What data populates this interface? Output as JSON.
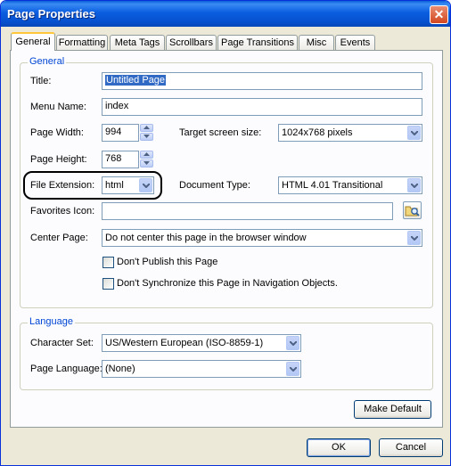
{
  "window": {
    "title": "Page Properties",
    "close_glyph": "✕"
  },
  "tabs": [
    "General",
    "Formatting",
    "Meta Tags",
    "Scrollbars",
    "Page Transitions",
    "Misc",
    "Events"
  ],
  "active_tab": "General",
  "general_group": {
    "title": "General",
    "title_label": "Title:",
    "title_value": "Untitled Page",
    "menu_name_label": "Menu Name:",
    "menu_name_value": "index",
    "page_width_label": "Page Width:",
    "page_width_value": "994",
    "target_screen_label": "Target screen size:",
    "target_screen_value": "1024x768 pixels",
    "page_height_label": "Page Height:",
    "page_height_value": "768",
    "file_ext_label": "File Extension:",
    "file_ext_value": "html",
    "doc_type_label": "Document Type:",
    "doc_type_value": "HTML 4.01 Transitional",
    "favorites_label": "Favorites Icon:",
    "favorites_value": "",
    "center_page_label": "Center Page:",
    "center_page_value": "Do not center this page in the browser window",
    "dont_publish_label": "Don't Publish this Page",
    "dont_publish_checked": false,
    "dont_sync_label": "Don't Synchronize this Page in Navigation Objects.",
    "dont_sync_checked": false
  },
  "language_group": {
    "title": "Language",
    "charset_label": "Character Set:",
    "charset_value": "US/Western European (ISO-8859-1)",
    "page_lang_label": "Page Language:",
    "page_lang_value": "(None)"
  },
  "buttons": {
    "make_default": "Make Default",
    "ok": "OK",
    "cancel": "Cancel"
  },
  "colors": {
    "title_bar": "#0b5ee0",
    "group_title": "#0046d5",
    "active_tab_accent": "#ffc83c",
    "close_button": "#d2471f"
  }
}
